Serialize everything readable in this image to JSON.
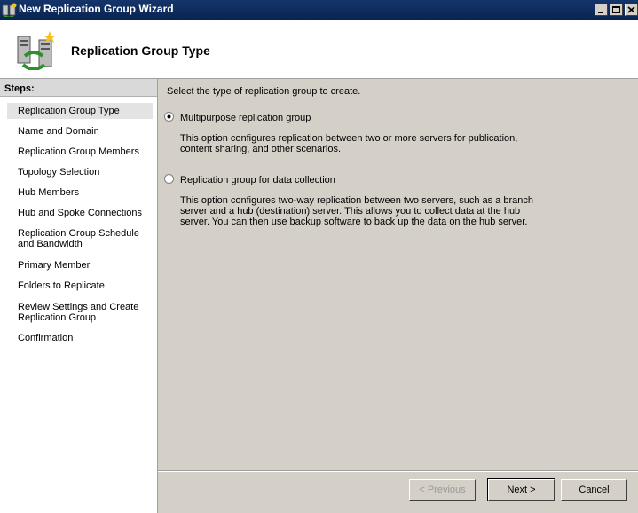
{
  "window": {
    "title": "New Replication Group Wizard"
  },
  "header": {
    "title": "Replication Group Type"
  },
  "steps": {
    "heading": "Steps:",
    "items": [
      {
        "label": "Replication Group Type"
      },
      {
        "label": "Name and Domain"
      },
      {
        "label": "Replication Group Members"
      },
      {
        "label": "Topology Selection"
      },
      {
        "label": "Hub Members"
      },
      {
        "label": "Hub and Spoke Connections"
      },
      {
        "label": "Replication Group Schedule and Bandwidth"
      },
      {
        "label": "Primary Member"
      },
      {
        "label": "Folders to Replicate"
      },
      {
        "label": "Review Settings and Create Replication Group"
      },
      {
        "label": "Confirmation"
      }
    ]
  },
  "main": {
    "prompt": "Select the type of replication group to create.",
    "options": [
      {
        "label": "Multipurpose replication group",
        "selected": true,
        "description": "This option configures replication between two or more servers for publication, content sharing, and other scenarios."
      },
      {
        "label": "Replication group for data collection",
        "selected": false,
        "description": "This option configures two-way replication between two servers, such as a branch server and a hub (destination) server. This allows you to collect data at the hub server. You can then use backup software to back up the data on the hub server."
      }
    ]
  },
  "buttons": {
    "previous": "< Previous",
    "next": "Next >",
    "cancel": "Cancel"
  }
}
